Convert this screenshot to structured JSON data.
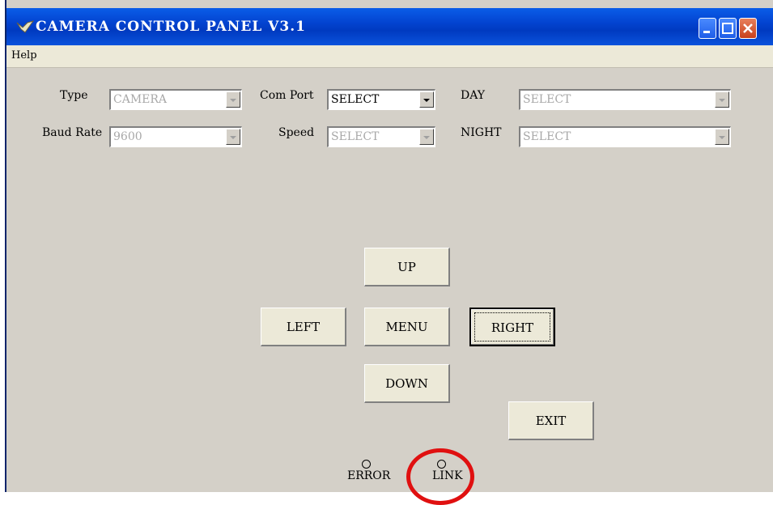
{
  "window": {
    "title": "CAMERA CONTROL PANEL V3.1",
    "controls": [
      "minimize",
      "maximize",
      "close"
    ],
    "title_color": "#0343d0"
  },
  "menu": {
    "help": "Help"
  },
  "settings": {
    "type_label": "Type",
    "type_value": "CAMERA",
    "comport_label": "Com Port",
    "comport_value": "SELECT",
    "day_label": "DAY",
    "day_value": "SELECT",
    "baud_label": "Baud Rate",
    "baud_value": "9600",
    "speed_label": "Speed",
    "speed_value": "SELECT",
    "night_label": "NIGHT",
    "night_value": "SELECT"
  },
  "pad": {
    "up": "UP",
    "left": "LEFT",
    "menu": "MENU",
    "right": "RIGHT",
    "down": "DOWN",
    "exit": "EXIT"
  },
  "status": {
    "error_label": "ERROR",
    "link_label": "LINK"
  },
  "annotation_color": "#e01010"
}
